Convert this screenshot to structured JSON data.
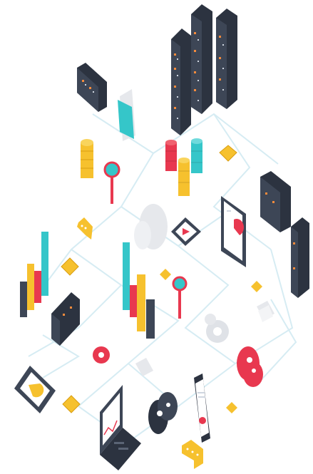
{
  "scene": {
    "palette": {
      "dark": "#3d4656",
      "darker": "#2c3340",
      "light_led": "#cfd6e0",
      "orange": "#f58b3c",
      "yellow": "#f6c12e",
      "red": "#e8384f",
      "teal": "#35c6c9",
      "line": "#d6ecf3",
      "grey": "#e6e8ec",
      "white": "#ffffff"
    }
  }
}
